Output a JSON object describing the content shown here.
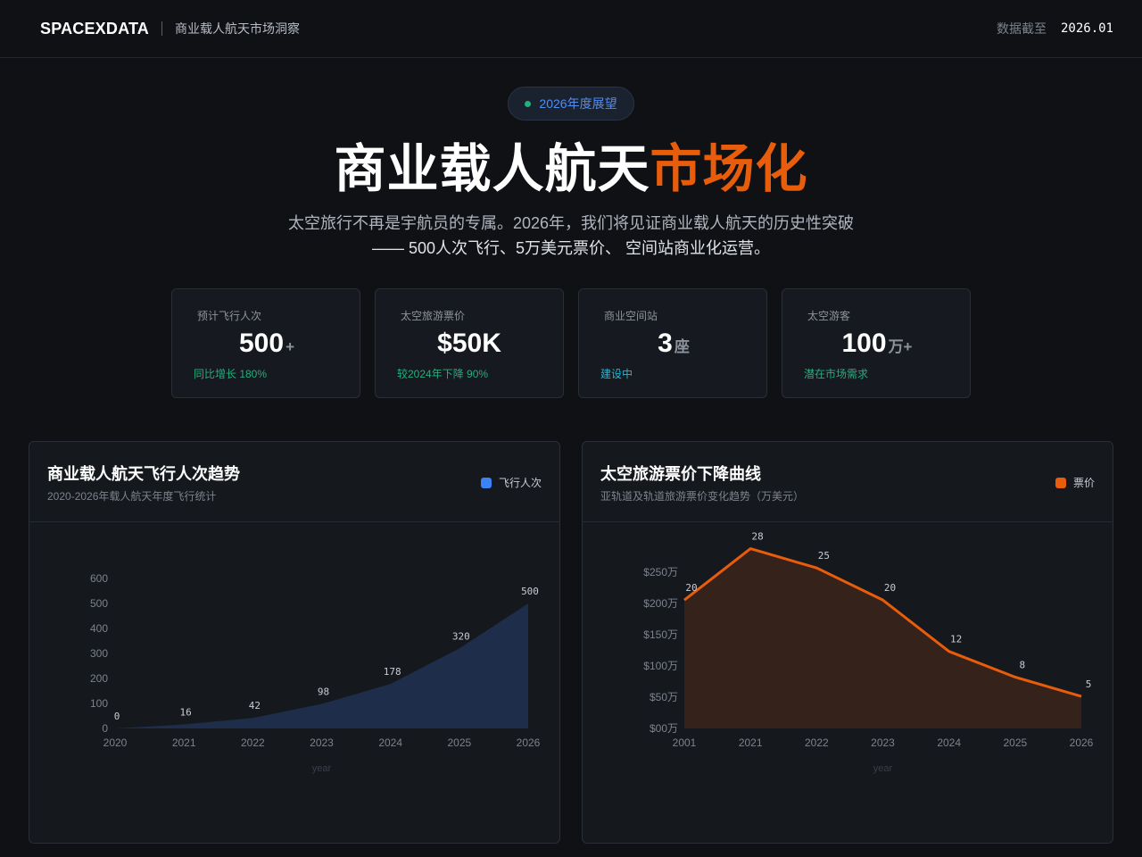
{
  "header": {
    "logo": "SPACEXDATA",
    "subtitle": "商业载人航天市场洞察",
    "asof_label": "数据截至",
    "asof_value": "2026.01"
  },
  "hero": {
    "badge": "2026年度展望",
    "title_main": "商业载人航天",
    "title_accent": "市场化",
    "desc_line1": "太空旅行不再是宇航员的专属。2026年，我们将见证商业载人航天的历史性突破",
    "desc_line2": "—— 500人次飞行、5万美元票价、 空间站商业化运营。"
  },
  "stats": [
    {
      "label": "预计飞行人次",
      "value": "500",
      "unit": "+",
      "note": "同比增长 180%",
      "note_color": "green"
    },
    {
      "label": "太空旅游票价",
      "value": "$50K",
      "unit": "",
      "note": "较2024年下降 90%",
      "note_color": "green"
    },
    {
      "label": "商业空间站",
      "value": "3",
      "unit": "座",
      "note": "建设中",
      "note_color": "cyan"
    },
    {
      "label": "太空游客",
      "value": "100",
      "unit": "万+",
      "note": "潜在市场需求",
      "note_color": "green"
    }
  ],
  "colors": {
    "blue": "#3b82f6",
    "blue_fill": "#1e2d4a",
    "orange": "#e85d0c",
    "orange_fill": "#35221b"
  },
  "panels": {
    "flights": {
      "title": "商业载人航天飞行人次趋势",
      "subtitle": "2020-2026年载人航天年度飞行统计",
      "legend": "飞行人次"
    },
    "price": {
      "title": "太空旅游票价下降曲线",
      "subtitle": "亚轨道及轨道旅游票价变化趋势（万美元）",
      "legend": "票价"
    }
  },
  "chart_data": [
    {
      "type": "area",
      "x": [
        "2020",
        "2021",
        "2022",
        "2023",
        "2024",
        "2025",
        "2026"
      ],
      "series": [
        {
          "name": "飞行人次",
          "values": [
            0,
            16,
            42,
            98,
            178,
            320,
            500
          ]
        }
      ],
      "ylim": [
        0,
        600
      ],
      "yticks": [
        "0",
        "100",
        "200",
        "300",
        "400",
        "500",
        "600"
      ],
      "xlabel": "year",
      "ylabel": "",
      "grid": false
    },
    {
      "type": "area",
      "x": [
        "2001",
        "2021",
        "2022",
        "2023",
        "2024",
        "2025",
        "2026"
      ],
      "series": [
        {
          "name": "票价",
          "values": [
            20,
            28,
            25,
            20,
            12,
            8,
            5
          ]
        }
      ],
      "ylim": [
        0,
        26
      ],
      "yticks": [
        "$00万",
        "$50万",
        "$100万",
        "$150万",
        "$200万",
        "$250万"
      ],
      "xlabel": "year",
      "ylabel": "",
      "grid": false
    }
  ]
}
